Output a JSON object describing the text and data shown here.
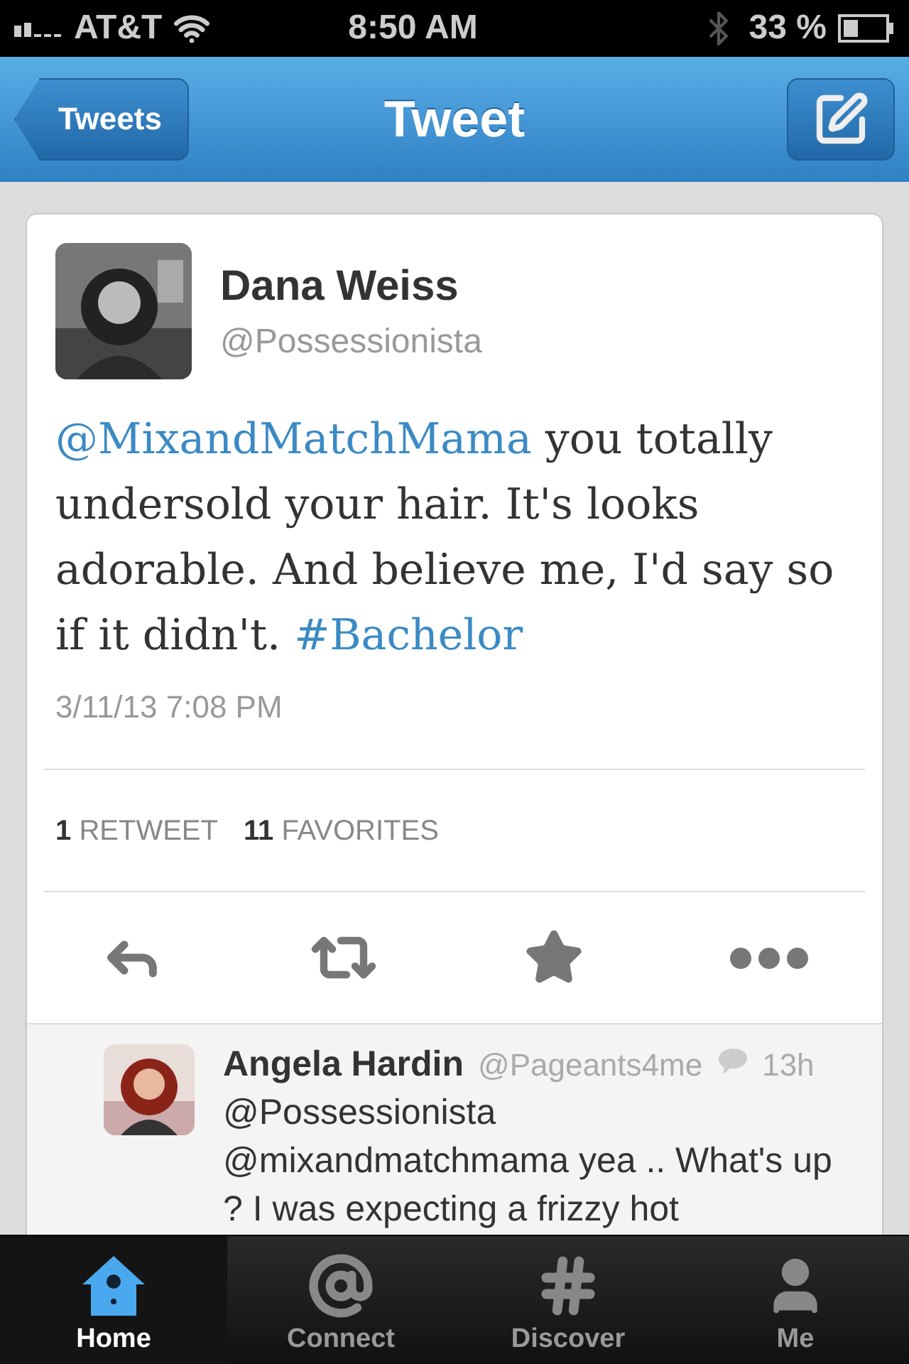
{
  "status_bar": {
    "carrier": "AT&T",
    "time": "8:50 AM",
    "battery": "33 %"
  },
  "nav": {
    "back": "Tweets",
    "title": "Tweet"
  },
  "tweet": {
    "name": "Dana Weiss",
    "handle": "@Possessionista",
    "text": [
      {
        "kind": "link",
        "text": "@MixandMatchMama"
      },
      {
        "kind": "plain",
        "text": " you totally undersold your hair. It's looks adorable. And believe me, I'd say so if it didn't. "
      },
      {
        "kind": "link",
        "text": "#Bachelor"
      }
    ],
    "date": "3/11/13 7:08 PM",
    "stats": [
      {
        "count": "1",
        "label": "RETWEET"
      },
      {
        "count": "11",
        "label": "FAVORITES"
      }
    ],
    "actions": [
      {
        "kind": "reply"
      },
      {
        "kind": "retweet"
      },
      {
        "kind": "favorite"
      },
      {
        "kind": "more"
      }
    ]
  },
  "reply": {
    "name": "Angela Hardin",
    "handle": "@Pageants4me",
    "time": "13h",
    "text": "@Possessionista @mixandmatchmama yea .. What's up ? I was expecting a frizzy hot"
  },
  "tabs": [
    {
      "kind": "home",
      "label": "Home",
      "selected": true
    },
    {
      "kind": "connect",
      "label": "Connect",
      "selected": false
    },
    {
      "kind": "discover",
      "label": "Discover",
      "selected": false
    },
    {
      "kind": "me",
      "label": "Me",
      "selected": false
    }
  ]
}
